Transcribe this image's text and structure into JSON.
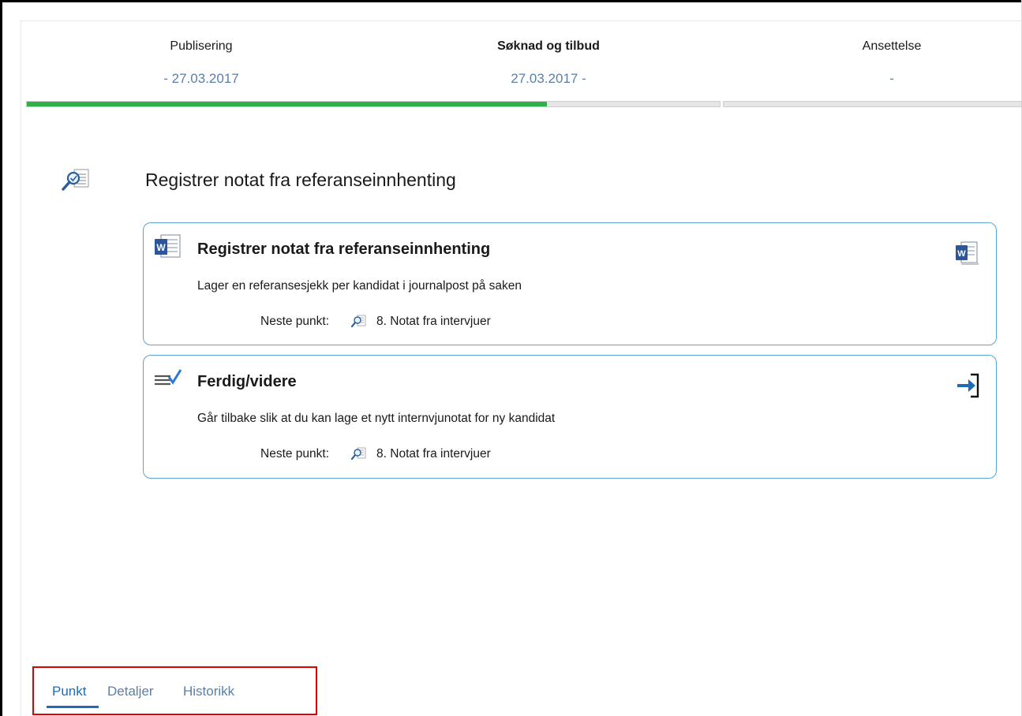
{
  "phases": [
    {
      "name": "Publisering",
      "date": "- 27.03.2017",
      "active": false
    },
    {
      "name": "Søknad og tilbud",
      "date": "27.03.2017 -",
      "active": true
    },
    {
      "name": "Ansettelse",
      "date": "-",
      "active": false
    }
  ],
  "progress": {
    "phase_fill_fraction": 0.75
  },
  "main": {
    "icon": "magnifier-document-icon",
    "title": "Registrer notat fra referanseinnhenting"
  },
  "cards": [
    {
      "icon": "word-document-icon",
      "title": "Registrer notat fra referanseinnhenting",
      "description": "Lager en referansesjekk per kandidat i journalpost på saken",
      "next_label": "Neste punkt:",
      "next_icon": "magnifier-document-icon",
      "next_value": "8. Notat fra intervjuer",
      "action_icon": "word-document-icon"
    },
    {
      "icon": "checklist-icon",
      "title": "Ferdig/videre",
      "description": "Går tilbake slik at du kan lage et nytt internvjunotat  for ny kandidat",
      "next_label": "Neste punkt:",
      "next_icon": "magnifier-document-icon",
      "next_value": "8. Notat fra intervjuer",
      "action_icon": "enter-arrow-icon"
    }
  ],
  "tabs": [
    {
      "label": "Punkt",
      "active": true
    },
    {
      "label": "Detaljer",
      "active": false
    },
    {
      "label": "Historikk",
      "active": false
    }
  ],
  "colors": {
    "progress": "#2fb14a",
    "accent": "#1f6bb8",
    "highlight": "#e00000",
    "card_border": "#5aa4d6"
  }
}
